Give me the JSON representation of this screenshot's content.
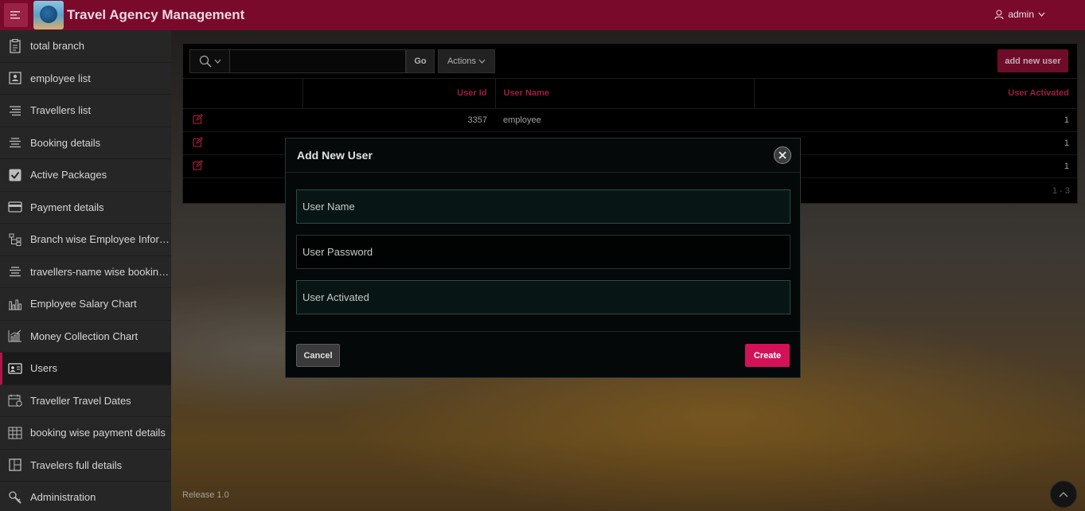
{
  "app": {
    "title": "Travel Agency Management",
    "user": "admin"
  },
  "sidebar": {
    "items": [
      {
        "label": "total branch",
        "icon": "clipboard-icon"
      },
      {
        "label": "employee list",
        "icon": "id-card-icon"
      },
      {
        "label": "Travellers list",
        "icon": "list-icon"
      },
      {
        "label": "Booking details",
        "icon": "align-icon"
      },
      {
        "label": "Active Packages",
        "icon": "checkbox-icon"
      },
      {
        "label": "Payment details",
        "icon": "card-icon"
      },
      {
        "label": "Branch wise Employee Inform...",
        "icon": "hierarchy-icon"
      },
      {
        "label": "travellers-name wise booking ...",
        "icon": "align-icon"
      },
      {
        "label": "Employee Salary Chart",
        "icon": "bar-chart-icon"
      },
      {
        "label": "Money Collection Chart",
        "icon": "line-chart-icon"
      },
      {
        "label": "Users",
        "icon": "user-card-icon",
        "active": true
      },
      {
        "label": "Traveller Travel Dates",
        "icon": "calendar-icon"
      },
      {
        "label": "booking wise payment details",
        "icon": "table-icon"
      },
      {
        "label": "Travelers full details",
        "icon": "layout-icon"
      },
      {
        "label": "Administration",
        "icon": "wrench-icon"
      }
    ]
  },
  "report": {
    "go_label": "Go",
    "actions_label": "Actions",
    "add_label": "add new user",
    "columns": [
      "User Id",
      "User Name",
      "User Activated"
    ],
    "rows": [
      {
        "id": "3357",
        "name": "employee",
        "activated": "1"
      },
      {
        "id": "",
        "name": "",
        "activated": "1"
      },
      {
        "id": "",
        "name": "",
        "activated": "1"
      }
    ],
    "pager": "1 - 3"
  },
  "footer": {
    "release": "Release 1.0"
  },
  "dialog": {
    "title": "Add New User",
    "fields": [
      "User Name",
      "User Password",
      "User Activated"
    ],
    "cancel_label": "Cancel",
    "create_label": "Create"
  },
  "colors": {
    "header": "#7a0a2c",
    "accent": "#c7254e",
    "create": "#d31158"
  }
}
